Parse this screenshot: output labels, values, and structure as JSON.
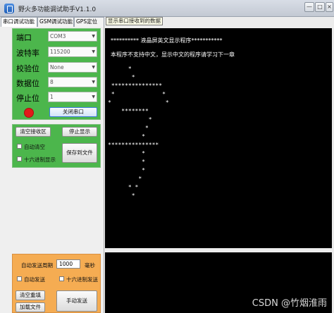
{
  "window": {
    "title": "野火多功能调试助手V1.1.0",
    "controls": [
      "—",
      "□",
      "×"
    ]
  },
  "tabs": [
    {
      "label": "串口调试功能",
      "active": true
    },
    {
      "label": "GSM调试功能",
      "active": false
    },
    {
      "label": "GPS定位",
      "active": false
    }
  ],
  "tooltip": "显示串口接收到的数据",
  "serial_settings": {
    "port_label": "端口",
    "port_value": "COM3",
    "baud_label": "波特率",
    "baud_value": "115200",
    "parity_label": "校验位",
    "parity_value": "None",
    "data_bits_label": "数据位",
    "data_bits_value": "8",
    "stop_bits_label": "停止位",
    "stop_bits_value": "1",
    "close_button": "关闭串口",
    "status_led_color": "#e21a1a"
  },
  "receive_settings": {
    "clear_button": "清空接收区",
    "stop_display_button": "停止显示",
    "auto_clear_label": "自动清空",
    "hex_display_label": "十六进制显示",
    "save_button": "保存到文件"
  },
  "send_settings": {
    "auto_send_label": "自动发送周期",
    "period_value": "1000",
    "unit_label": "毫秒",
    "auto_send_check_label": "自动发送",
    "hex_send_label": "十六进制发送",
    "clear_send_button": "清空重填",
    "load_file_button": "加载文件",
    "manual_send_button": "手动发送"
  },
  "terminal": {
    "header_line": "********** 液晶屏英文显示程序***********",
    "info_line": "本程序不支持中文，显示中文的程序请学习下一章",
    "ascii_art": [
      "      *",
      "       *",
      " ***************",
      " *              *",
      "*                *",
      "    ********",
      "            *",
      "           *",
      "          *",
      "***************",
      "          *",
      "          *",
      "          *",
      "         *",
      "      * *",
      "       *"
    ]
  },
  "watermark": "CSDN @竹烟淮雨"
}
